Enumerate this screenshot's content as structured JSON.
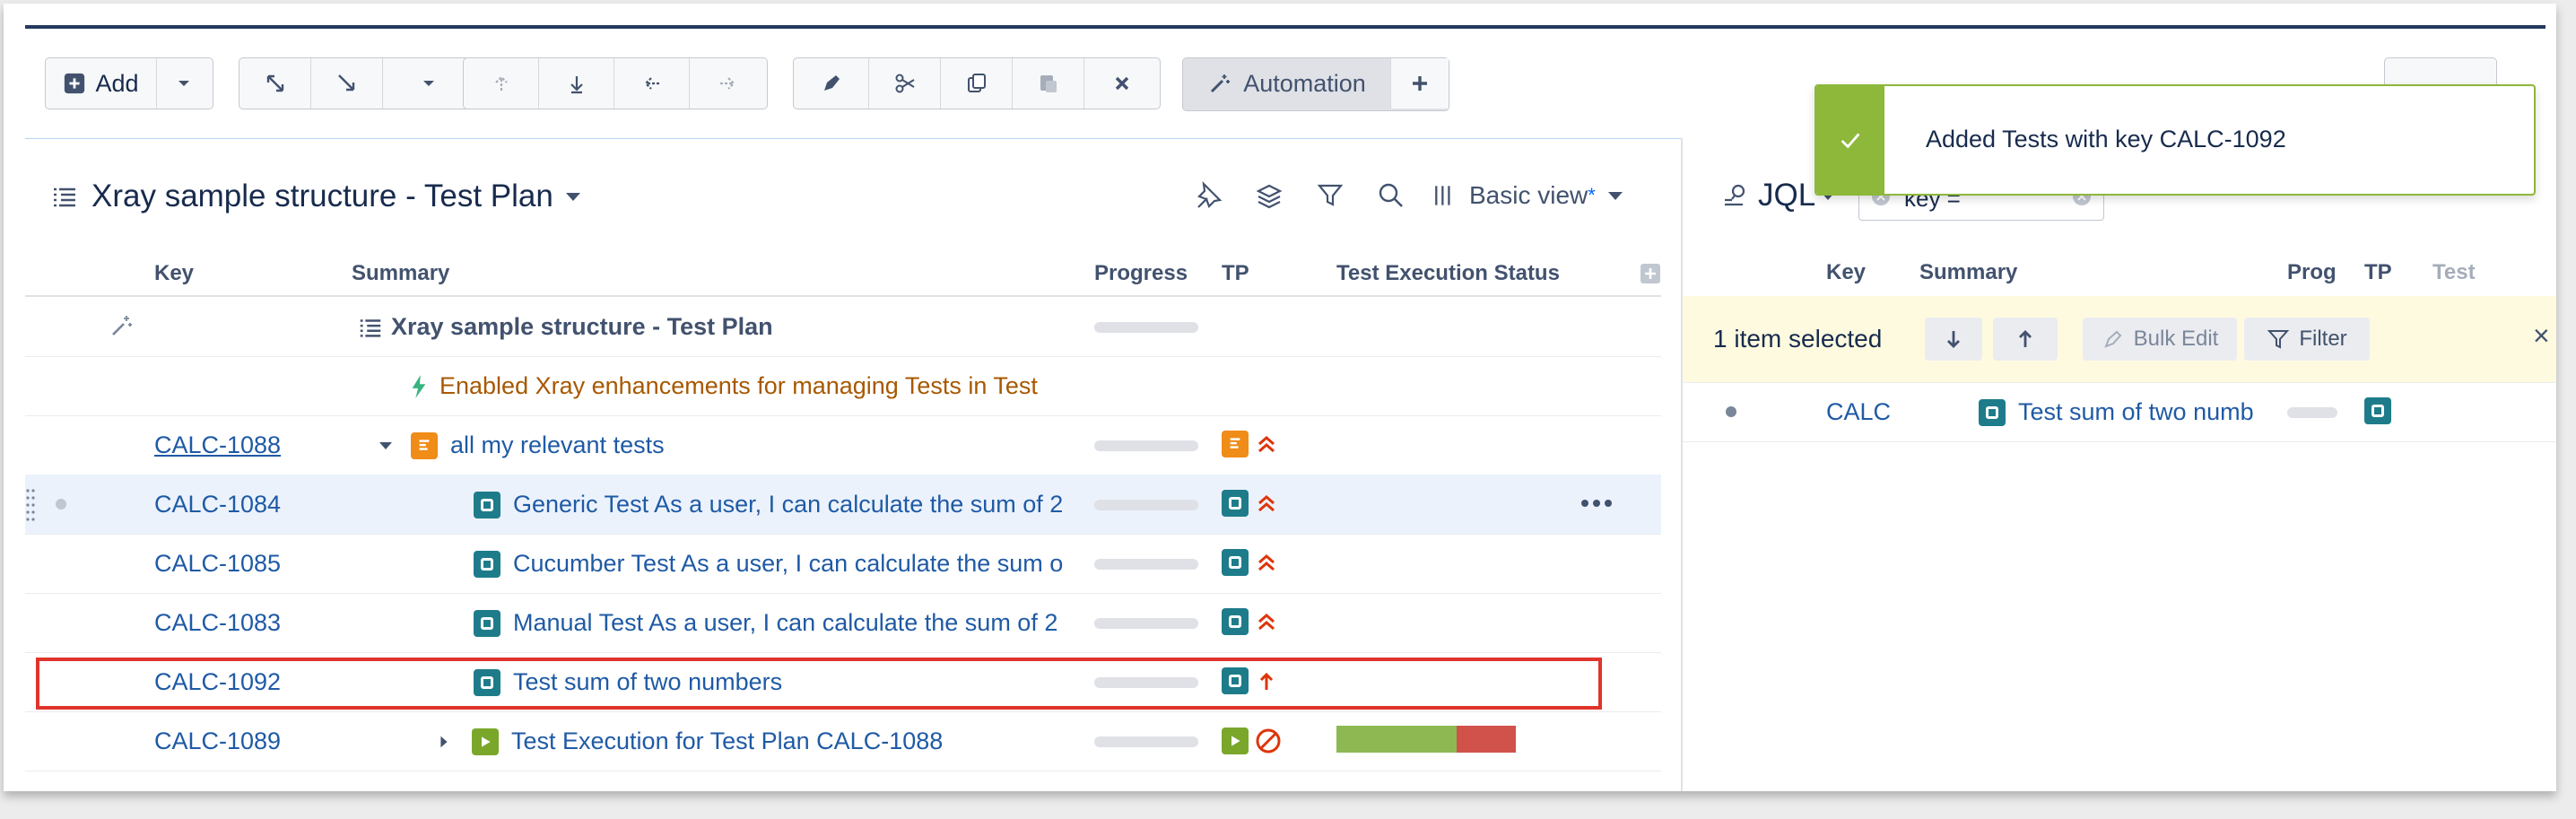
{
  "toolbar": {
    "add_label": "Add",
    "automation_label": "Automation"
  },
  "left_panel": {
    "title": "Xray sample structure - Test Plan",
    "view_label": "Basic view",
    "view_modified_mark": "*",
    "columns": {
      "key": "Key",
      "summary": "Summary",
      "progress": "Progress",
      "tp": "TP",
      "status": "Test Execution Status"
    },
    "rows": [
      {
        "key": "",
        "summary": "Xray sample structure - Test Plan",
        "type": "root"
      },
      {
        "key": "",
        "summary": "Enabled Xray enhancements for managing Tests in Test",
        "type": "generator"
      },
      {
        "key": "CALC-1088",
        "summary": "all my relevant tests",
        "type": "plan"
      },
      {
        "key": "CALC-1084",
        "summary": "Generic Test As a user, I can calculate the sum of 2",
        "type": "test"
      },
      {
        "key": "CALC-1085",
        "summary": "Cucumber Test As a user, I can calculate the sum o",
        "type": "test"
      },
      {
        "key": "CALC-1083",
        "summary": "Manual Test As a user, I can calculate the sum of 2",
        "type": "test"
      },
      {
        "key": "CALC-1092",
        "summary": "Test sum of two numbers",
        "type": "test"
      },
      {
        "key": "CALC-1089",
        "summary": "Test Execution for Test Plan CALC-1088",
        "type": "exec"
      }
    ],
    "exec_status": {
      "passed_fraction": 0.67,
      "failed_fraction": 0.33
    },
    "colors": {
      "passed": "#8db852",
      "failed": "#d0524b",
      "highlight": "#e0342b"
    }
  },
  "right_panel": {
    "jql_label": "JQL",
    "query_value": "key =",
    "columns": {
      "key": "Key",
      "summary": "Summary",
      "progress": "Prog",
      "tp": "TP",
      "test": "Test"
    },
    "selection_text": "1 item selected",
    "bulk_edit_label": "Bulk Edit",
    "filter_label": "Filter",
    "close_glyph": "×",
    "row": {
      "key": "CALC",
      "summary": "Test sum of two numb"
    }
  },
  "toast": {
    "message": "Added Tests with key CALC-1092"
  }
}
